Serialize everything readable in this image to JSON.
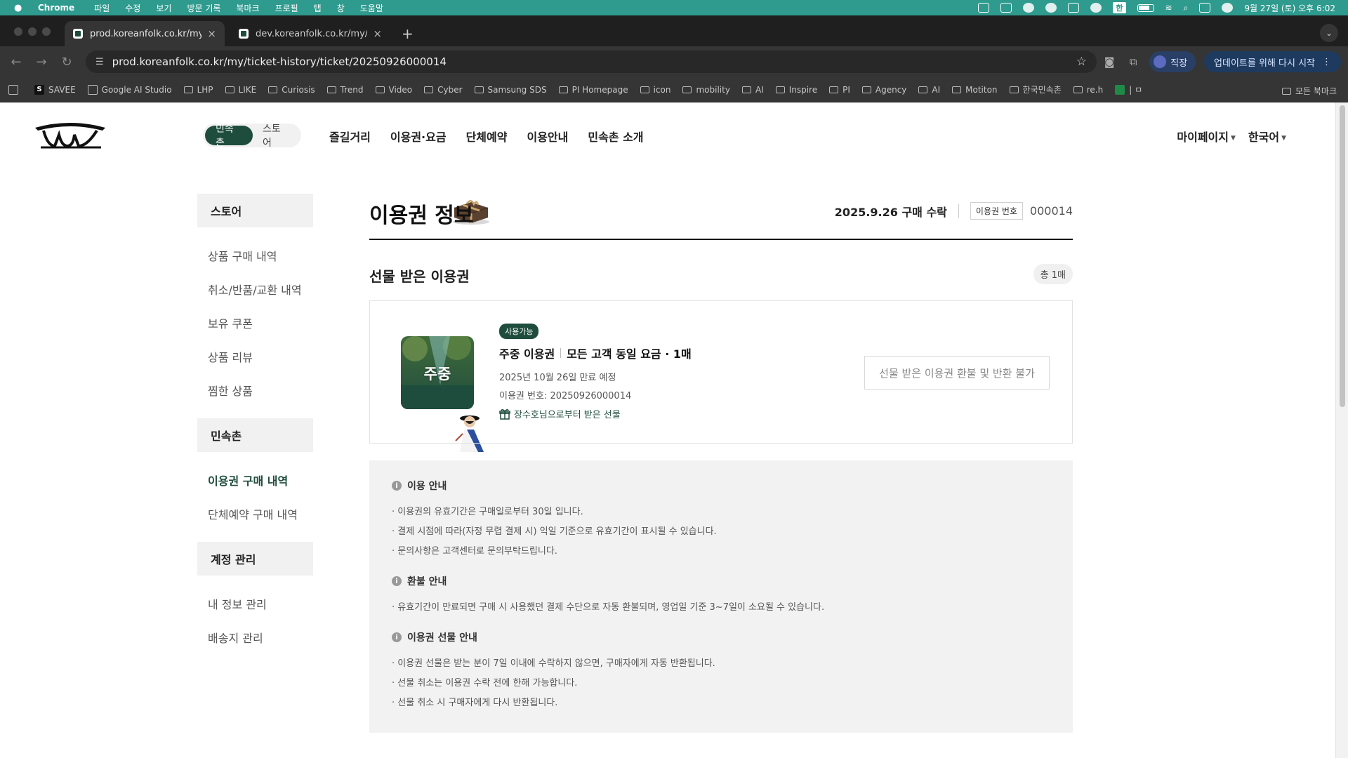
{
  "macbar": {
    "app": "Chrome",
    "menus": [
      "파일",
      "수정",
      "보기",
      "방문 기록",
      "북마크",
      "프로필",
      "탭",
      "창",
      "도움말"
    ],
    "ime": "한",
    "clock": "9월 27일 (토) 오후 6:02"
  },
  "browser": {
    "tabs": [
      {
        "title": "prod.koreanfolk.co.kr/my/ticke"
      },
      {
        "title": "dev.koreanfolk.co.kr/my/ticke"
      }
    ],
    "url": "prod.koreanfolk.co.kr/my/ticket-history/ticket/20250926000014",
    "profile_label": "직장",
    "update_label": "업데이트를 위해 다시 시작",
    "bookmarks": [
      "SAVEE",
      "Google AI Studio",
      "LHP",
      "LIKE",
      "Curiosis",
      "Trend",
      "Video",
      "Cyber",
      "Samsung SDS",
      "PI Homepage",
      "icon",
      "mobility",
      "AI",
      "Inspire",
      "PI",
      "Agency",
      "AI",
      "Motiton",
      "한국민속촌",
      "re.h",
      "| ㅁ"
    ],
    "all_bookmarks": "모든 북마크"
  },
  "header": {
    "segment": {
      "active": "민속촌",
      "inactive": "스토어"
    },
    "nav": [
      "즐길거리",
      "이용권·요금",
      "단체예약",
      "이용안내",
      "민속촌 소개"
    ],
    "mypage": "마이페이지",
    "language": "한국어"
  },
  "sidebar": {
    "store_title": "스토어",
    "store_items": [
      "상품 구매 내역",
      "취소/반품/교환 내역",
      "보유 쿠폰",
      "상품 리뷰",
      "찜한 상품"
    ],
    "folk_title": "민속촌",
    "folk_items": [
      "이용권 구매 내역",
      "단체예약 구매 내역"
    ],
    "account_title": "계정 관리",
    "account_items": [
      "내 정보 관리",
      "배송지 관리"
    ]
  },
  "content": {
    "title": "이용권 정보",
    "purchase_date": "2025.9.26 구매 수락",
    "ticket_no_label": "이용권 번호",
    "ticket_no": "000014",
    "section_title": "선물 받은 이용권",
    "total": "총 1매",
    "ticket": {
      "thumb_label": "주중",
      "badge": "사용가능",
      "name": "주중 이용권",
      "desc": "모든 고객 동일 요금 · 1매",
      "expiry": "2025년 10월 26일 만료 예정",
      "number": "이용권 번호: 20250926000014",
      "gift_from": "장수호님으로부터 받은 선물",
      "refund_button": "선물 받은 이용권 환불 및 반환 불가"
    },
    "notices": [
      {
        "title": "이용 안내",
        "lines": [
          "· 이용권의 유효기간은 구매일로부터 30일 입니다.",
          "· 결제 시점에 따라(자정 무렵 결제 시) 익일 기준으로 유효기간이 표시될 수 있습니다.",
          "· 문의사항은 고객센터로 문의부탁드립니다."
        ]
      },
      {
        "title": "환불 안내",
        "lines": [
          "· 유효기간이 만료되면 구매 시 사용했던 결제 수단으로 자동 환불되며, 영업일 기준 3~7일이 소요될 수 있습니다."
        ]
      },
      {
        "title": "이용권 선물 안내",
        "lines": [
          "· 이용권 선물은 받는 분이 7일 이내에 수락하지 않으면, 구매자에게 자동 반환됩니다.",
          "· 선물 취소는 이용권 수락 전에 한해 가능합니다.",
          "· 선물 취소 시 구매자에게 다시 반환됩니다."
        ]
      }
    ]
  },
  "colors": {
    "brand": "#1f4d3d",
    "macbar": "#2f9a8e"
  }
}
